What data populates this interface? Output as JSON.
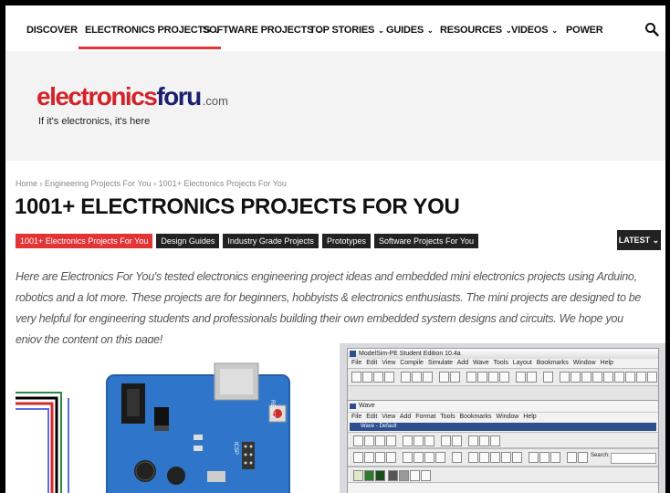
{
  "nav": {
    "items": [
      {
        "label": "DISCOVER",
        "dropdown": false
      },
      {
        "label": "ELECTRONICS PROJECTS",
        "dropdown": true
      },
      {
        "label": "SOFTWARE PROJECTS",
        "dropdown": true
      },
      {
        "label": "TOP STORIES",
        "dropdown": true
      },
      {
        "label": "GUIDES",
        "dropdown": true
      },
      {
        "label": "RESOURCES",
        "dropdown": true
      },
      {
        "label": "VIDEOS",
        "dropdown": true
      },
      {
        "label": "POWER",
        "dropdown": false
      }
    ],
    "chevron": "⌄",
    "search_icon": "search-icon",
    "accent_color": "#e23335"
  },
  "logo": {
    "part1": "electronics",
    "part2": "foru",
    "suffix": ".com",
    "tagline": "If it's electronics, it's here",
    "colors": {
      "red": "#d3232a",
      "navy": "#1a1f6e"
    }
  },
  "breadcrumb": {
    "text": "Home  ›  Engineering Projects For You  ›  1001+ Electronics Projects For You"
  },
  "page": {
    "title": "1001+ ELECTRONICS PROJECTS FOR YOU",
    "intro": "Here are Electronics For You's tested electronics engineering project ideas and embedded mini electronics projects using Arduino, robotics and a lot more. These projects are for beginners, hobbyists & electronics enthusiasts. The mini projects are designed to be very helpful for engineering students and professionals building their own embedded system designs and circuits. We hope you enjoy the content on this page!"
  },
  "tags": [
    {
      "label": "1001+ Electronics Projects For You",
      "active": true
    },
    {
      "label": "Design Guides",
      "active": false
    },
    {
      "label": "Industry Grade Projects",
      "active": false
    },
    {
      "label": "Prototypes",
      "active": false
    },
    {
      "label": "Software Projects For You",
      "active": false
    }
  ],
  "sort": {
    "label": "LATEST",
    "chevron": "⌄"
  },
  "thumbnail_right": {
    "window_title": "ModelSim-PE Student Edition 10.4a",
    "menu": "File  Edit  View  Compile  Simulate  Add  Wave  Tools  Layout  Bookmarks  Window  Help",
    "sub_title": "Wave",
    "sub_menu": "File  Edit  View  Add  Format  Tools  Bookmarks  Window  Help",
    "wave_bar": "Wave - Default",
    "search_label": "Search:"
  }
}
